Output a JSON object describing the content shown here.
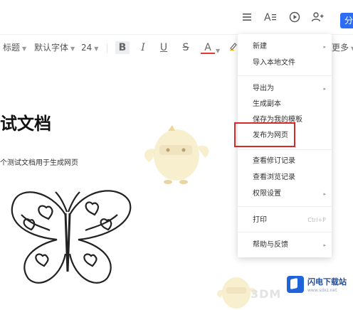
{
  "toolbar": {
    "style_label": "标题",
    "font_label": "默认字体",
    "size_label": "24",
    "bold_label": "B",
    "italic_label": "I",
    "underline_label": "U",
    "strike_label": "S",
    "color_label": "A",
    "more_label": "更多"
  },
  "top_actions": {
    "share_label": "分"
  },
  "document": {
    "title": "试文档",
    "line1": "个测试文档用于生成网页"
  },
  "menu": {
    "items": [
      {
        "label": "新建",
        "arrow": "▸"
      },
      {
        "label": "导入本地文件"
      },
      {
        "label": "导出为",
        "arrow": "▸"
      },
      {
        "label": "生成副本"
      },
      {
        "label": "保存为我的模板"
      },
      {
        "label": "发布为网页"
      },
      {
        "label": "查看修订记录"
      },
      {
        "label": "查看浏览记录"
      },
      {
        "label": "权限设置",
        "arrow": "▸"
      },
      {
        "label": "打印",
        "shortcut": "Ctrl+P"
      },
      {
        "label": "帮助与反馈",
        "arrow": "▸"
      }
    ]
  },
  "watermark": {
    "brand_name": "闪电下载站",
    "brand_url": "www.sdxz.net",
    "text_3d": "3DM"
  },
  "colors": {
    "accent": "#2d6df6",
    "highlight": "#d62a2a",
    "text_color_underline": "#e53935"
  },
  "icons": {
    "menu": "hamburger-icon",
    "font_style": "font-style-icon",
    "play": "play-icon",
    "add_user": "add-user-icon"
  }
}
